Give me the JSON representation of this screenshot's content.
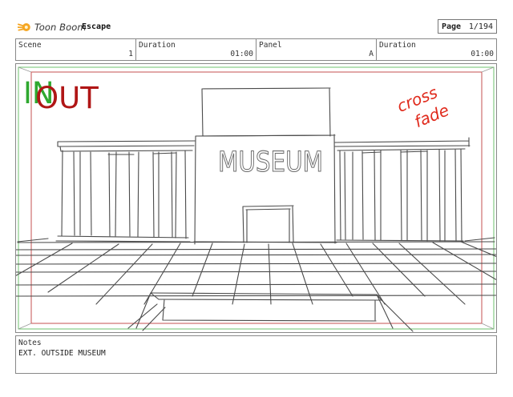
{
  "header": {
    "brand": "Toon Boom",
    "project": "Escape",
    "page_label": "Page",
    "page_value": "1/194"
  },
  "info": {
    "scene_label": "Scene",
    "scene_value": "1",
    "scene_duration_label": "Duration",
    "scene_duration_value": "01:00",
    "panel_label": "Panel",
    "panel_value": "A",
    "panel_duration_label": "Duration",
    "panel_duration_value": "01:00"
  },
  "panel": {
    "in_label": "IN",
    "out_label": "OUT",
    "transition_line1": "cross",
    "transition_line2": "fade",
    "sign_text": "MUSEUM",
    "colors": {
      "in": "#2fa82f",
      "out": "#b01616",
      "transition": "#e02a1c",
      "sketch": "#4a4a4a"
    }
  },
  "notes": {
    "label": "Notes",
    "text": "EXT. OUTSIDE MUSEUM"
  }
}
